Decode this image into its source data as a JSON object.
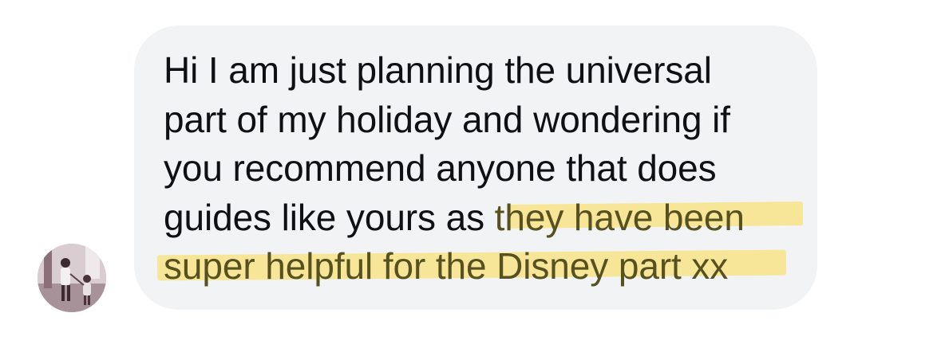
{
  "message": {
    "lines": [
      "Hi I am just planning the universal",
      "part of my holiday and wondering if",
      "you recommend anyone that does",
      "guides like yours as "
    ],
    "highlighted_lines": [
      "they have been",
      "super helpful for the Disney part xx"
    ],
    "highlight_color": "#f7e58f",
    "bubble_color": "#f2f3f5"
  },
  "avatar": {
    "icon": "profile-photo"
  }
}
